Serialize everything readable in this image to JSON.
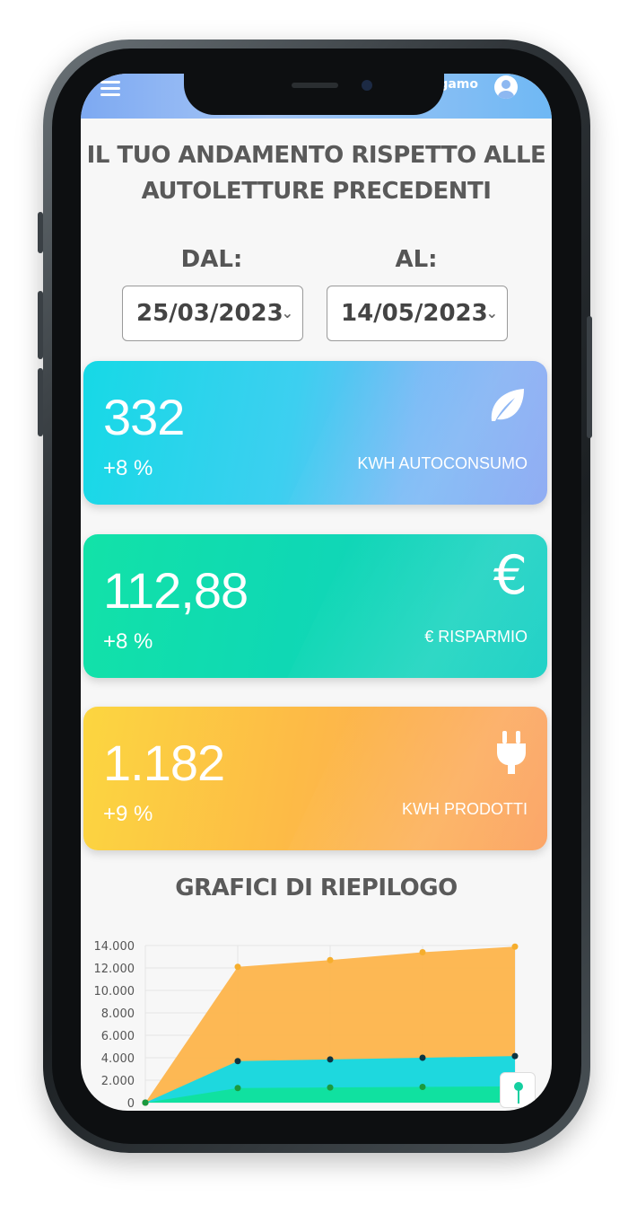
{
  "header": {
    "user_text": "gamo",
    "menu_icon": "hamburger-menu-icon",
    "user_icon": "user-avatar-icon"
  },
  "page": {
    "title_line1": "IL TUO ANDAMENTO RISPETTO ALLE",
    "title_line2": "AUTOLETTURE PRECEDENTI"
  },
  "dates": {
    "from_label": "DAL:",
    "from_value": "25/03/2023",
    "to_label": "AL:",
    "to_value": "14/05/2023"
  },
  "cards": [
    {
      "value": "332",
      "pct": "+8 %",
      "label": "KWH AUTOCONSUMO",
      "icon": "leaf-icon"
    },
    {
      "value": "112,88",
      "pct": "+8 %",
      "label": "€ RISPARMIO",
      "icon": "euro-icon"
    },
    {
      "value": "1.182",
      "pct": "+9 %",
      "label": "KWH PRODOTTI",
      "icon": "plug-icon"
    }
  ],
  "summary": {
    "title": "GRAFICI DI RIEPILOGO"
  },
  "chart_data": {
    "type": "area",
    "x": [
      0,
      1,
      2,
      3,
      4
    ],
    "ylim": [
      0,
      14000
    ],
    "yticks": [
      "14.000",
      "12.000",
      "10.000",
      "8.000",
      "6.000",
      "4.000",
      "2.000",
      "0"
    ],
    "series": [
      {
        "values": [
          0,
          12100,
          12700,
          13400,
          13900
        ],
        "color": "#fdb44b",
        "point": "#f6ae2d"
      },
      {
        "values": [
          0,
          3700,
          3850,
          4000,
          4150
        ],
        "color": "#12d9e6",
        "point": "#0d3340"
      },
      {
        "values": [
          0,
          1300,
          1350,
          1400,
          1450
        ],
        "color": "#10e29c",
        "point": "#1b9a3e"
      }
    ],
    "grid": true
  }
}
